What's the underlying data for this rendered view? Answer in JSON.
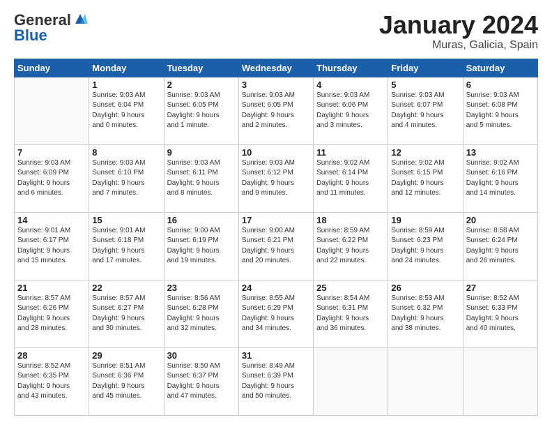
{
  "logo": {
    "general": "General",
    "blue": "Blue"
  },
  "title": "January 2024",
  "subtitle": "Muras, Galicia, Spain",
  "days_header": [
    "Sunday",
    "Monday",
    "Tuesday",
    "Wednesday",
    "Thursday",
    "Friday",
    "Saturday"
  ],
  "weeks": [
    [
      {
        "num": "",
        "info": ""
      },
      {
        "num": "1",
        "info": "Sunrise: 9:03 AM\nSunset: 6:04 PM\nDaylight: 9 hours\nand 0 minutes."
      },
      {
        "num": "2",
        "info": "Sunrise: 9:03 AM\nSunset: 6:05 PM\nDaylight: 9 hours\nand 1 minute."
      },
      {
        "num": "3",
        "info": "Sunrise: 9:03 AM\nSunset: 6:05 PM\nDaylight: 9 hours\nand 2 minutes."
      },
      {
        "num": "4",
        "info": "Sunrise: 9:03 AM\nSunset: 6:06 PM\nDaylight: 9 hours\nand 3 minutes."
      },
      {
        "num": "5",
        "info": "Sunrise: 9:03 AM\nSunset: 6:07 PM\nDaylight: 9 hours\nand 4 minutes."
      },
      {
        "num": "6",
        "info": "Sunrise: 9:03 AM\nSunset: 6:08 PM\nDaylight: 9 hours\nand 5 minutes."
      }
    ],
    [
      {
        "num": "7",
        "info": "Sunrise: 9:03 AM\nSunset: 6:09 PM\nDaylight: 9 hours\nand 6 minutes."
      },
      {
        "num": "8",
        "info": "Sunrise: 9:03 AM\nSunset: 6:10 PM\nDaylight: 9 hours\nand 7 minutes."
      },
      {
        "num": "9",
        "info": "Sunrise: 9:03 AM\nSunset: 6:11 PM\nDaylight: 9 hours\nand 8 minutes."
      },
      {
        "num": "10",
        "info": "Sunrise: 9:03 AM\nSunset: 6:12 PM\nDaylight: 9 hours\nand 9 minutes."
      },
      {
        "num": "11",
        "info": "Sunrise: 9:02 AM\nSunset: 6:14 PM\nDaylight: 9 hours\nand 11 minutes."
      },
      {
        "num": "12",
        "info": "Sunrise: 9:02 AM\nSunset: 6:15 PM\nDaylight: 9 hours\nand 12 minutes."
      },
      {
        "num": "13",
        "info": "Sunrise: 9:02 AM\nSunset: 6:16 PM\nDaylight: 9 hours\nand 14 minutes."
      }
    ],
    [
      {
        "num": "14",
        "info": "Sunrise: 9:01 AM\nSunset: 6:17 PM\nDaylight: 9 hours\nand 15 minutes."
      },
      {
        "num": "15",
        "info": "Sunrise: 9:01 AM\nSunset: 6:18 PM\nDaylight: 9 hours\nand 17 minutes."
      },
      {
        "num": "16",
        "info": "Sunrise: 9:00 AM\nSunset: 6:19 PM\nDaylight: 9 hours\nand 19 minutes."
      },
      {
        "num": "17",
        "info": "Sunrise: 9:00 AM\nSunset: 6:21 PM\nDaylight: 9 hours\nand 20 minutes."
      },
      {
        "num": "18",
        "info": "Sunrise: 8:59 AM\nSunset: 6:22 PM\nDaylight: 9 hours\nand 22 minutes."
      },
      {
        "num": "19",
        "info": "Sunrise: 8:59 AM\nSunset: 6:23 PM\nDaylight: 9 hours\nand 24 minutes."
      },
      {
        "num": "20",
        "info": "Sunrise: 8:58 AM\nSunset: 6:24 PM\nDaylight: 9 hours\nand 26 minutes."
      }
    ],
    [
      {
        "num": "21",
        "info": "Sunrise: 8:57 AM\nSunset: 6:26 PM\nDaylight: 9 hours\nand 28 minutes."
      },
      {
        "num": "22",
        "info": "Sunrise: 8:57 AM\nSunset: 6:27 PM\nDaylight: 9 hours\nand 30 minutes."
      },
      {
        "num": "23",
        "info": "Sunrise: 8:56 AM\nSunset: 6:28 PM\nDaylight: 9 hours\nand 32 minutes."
      },
      {
        "num": "24",
        "info": "Sunrise: 8:55 AM\nSunset: 6:29 PM\nDaylight: 9 hours\nand 34 minutes."
      },
      {
        "num": "25",
        "info": "Sunrise: 8:54 AM\nSunset: 6:31 PM\nDaylight: 9 hours\nand 36 minutes."
      },
      {
        "num": "26",
        "info": "Sunrise: 8:53 AM\nSunset: 6:32 PM\nDaylight: 9 hours\nand 38 minutes."
      },
      {
        "num": "27",
        "info": "Sunrise: 8:52 AM\nSunset: 6:33 PM\nDaylight: 9 hours\nand 40 minutes."
      }
    ],
    [
      {
        "num": "28",
        "info": "Sunrise: 8:52 AM\nSunset: 6:35 PM\nDaylight: 9 hours\nand 43 minutes."
      },
      {
        "num": "29",
        "info": "Sunrise: 8:51 AM\nSunset: 6:36 PM\nDaylight: 9 hours\nand 45 minutes."
      },
      {
        "num": "30",
        "info": "Sunrise: 8:50 AM\nSunset: 6:37 PM\nDaylight: 9 hours\nand 47 minutes."
      },
      {
        "num": "31",
        "info": "Sunrise: 8:49 AM\nSunset: 6:39 PM\nDaylight: 9 hours\nand 50 minutes."
      },
      {
        "num": "",
        "info": ""
      },
      {
        "num": "",
        "info": ""
      },
      {
        "num": "",
        "info": ""
      }
    ]
  ]
}
